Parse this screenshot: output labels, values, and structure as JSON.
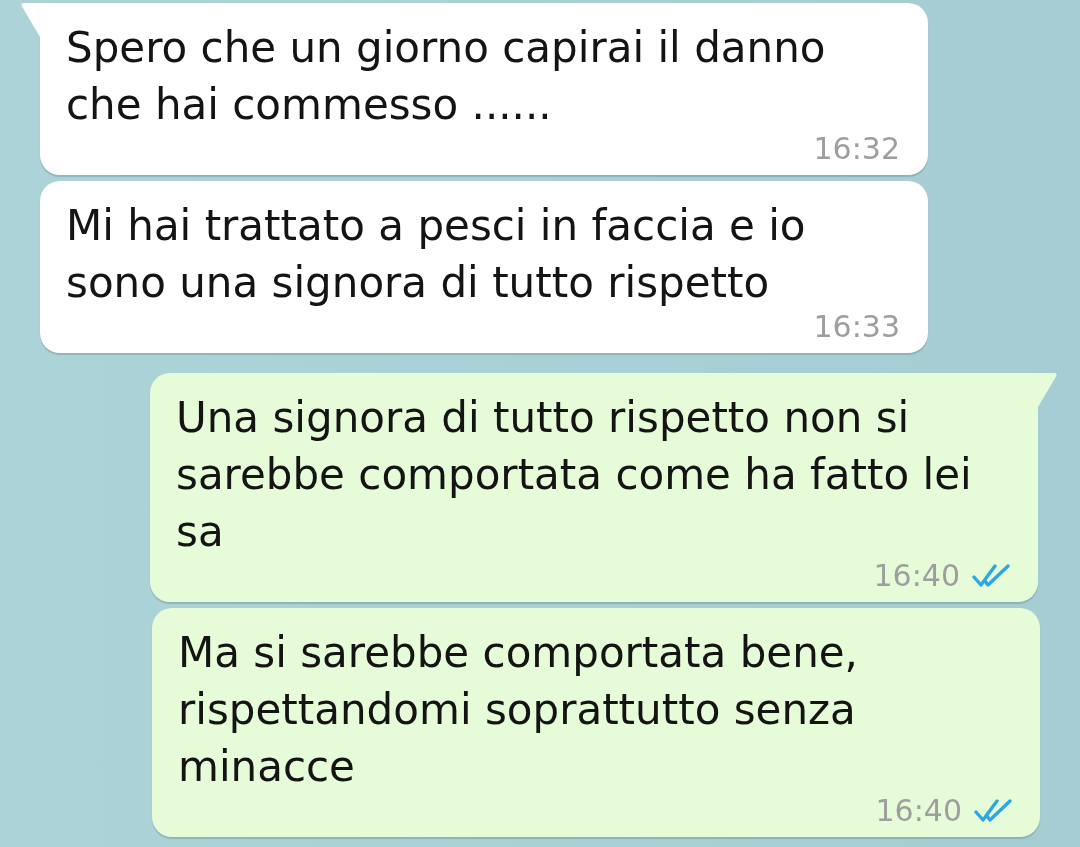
{
  "chat": {
    "messages": [
      {
        "kind": "incoming",
        "text": "Spero che un giorno capirai il danno che hai commesso ......",
        "time": "16:32"
      },
      {
        "kind": "incoming",
        "text": "Mi hai trattato a pesci in faccia e io sono una signora di tutto rispetto",
        "time": "16:33"
      },
      {
        "kind": "outgoing",
        "text": "Una signora di tutto rispetto non si sarebbe comportata come ha fatto lei sa",
        "time": "16:40",
        "read": true
      },
      {
        "kind": "outgoing",
        "text": "Ma si sarebbe comportata bene, rispettandomi soprattutto senza minacce",
        "time": "16:40",
        "read": true
      }
    ]
  }
}
